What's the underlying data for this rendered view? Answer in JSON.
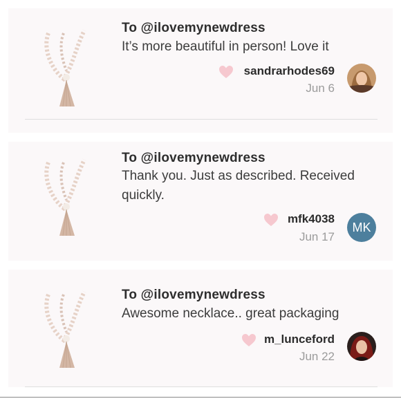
{
  "reviews": [
    {
      "to": "To @ilovemynewdress",
      "message": "It’s more beautiful in person! Love it",
      "username": "sandrarhodes69",
      "date": "Jun 6",
      "avatar": "photo"
    },
    {
      "to": "To @ilovemynewdress",
      "message": "Thank you. Just as described. Received quickly.",
      "username": "mfk4038",
      "date": "Jun 17",
      "avatar_initials": "MK",
      "avatar_color": "#4d7f9d"
    },
    {
      "to": "To @ilovemynewdress",
      "message": "Awesome necklace.. great packaging",
      "username": "m_lunceford",
      "date": "Jun 22",
      "avatar": "photo"
    }
  ],
  "colors": {
    "heart": "#f6c8cf",
    "card_background": "#fbf8f9",
    "date_text": "#9b9b9b"
  }
}
